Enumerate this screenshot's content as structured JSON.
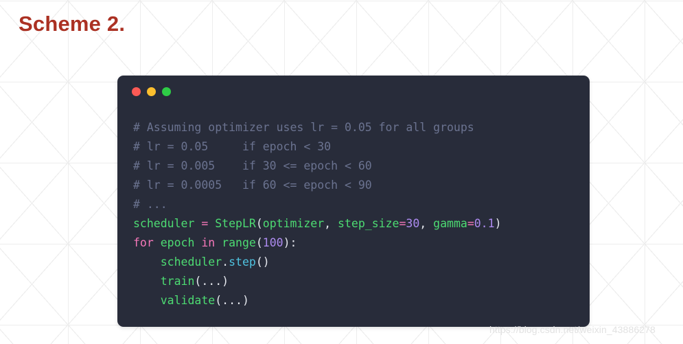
{
  "slide": {
    "title": "Scheme 2.",
    "title_color": "#ab3123",
    "background_color": "#ffffff",
    "grid_line_color": "#ededed"
  },
  "code_window": {
    "background_color": "#282c3a",
    "controls": [
      {
        "name": "close",
        "color": "#fc5a55"
      },
      {
        "name": "minimize",
        "color": "#fcbf2e"
      },
      {
        "name": "maximize",
        "color": "#2ecc46"
      }
    ],
    "language": "python",
    "palette": {
      "comment": "#6b7390",
      "name": "#4ddb72",
      "keyword": "#f778ba",
      "operator": "#f778ba",
      "number": "#ad8bf0",
      "method": "#4fc3e0",
      "punctuation": "#e6e9ef"
    },
    "code_plain_text": "# Assuming optimizer uses lr = 0.05 for all groups\n# lr = 0.05     if epoch < 30\n# lr = 0.005    if 30 <= epoch < 60\n# lr = 0.0005   if 60 <= epoch < 90\n# ...\nscheduler = StepLR(optimizer, step_size=30, gamma=0.1)\nfor epoch in range(100):\n    scheduler.step()\n    train(...)\n    validate(...)",
    "lines": [
      {
        "id": "line-1",
        "tokens": [
          {
            "t": "comment",
            "s": "# Assuming optimizer uses lr = 0.05 for all groups"
          }
        ]
      },
      {
        "id": "line-2",
        "tokens": [
          {
            "t": "comment",
            "s": "# lr = 0.05     if epoch < 30"
          }
        ]
      },
      {
        "id": "line-3",
        "tokens": [
          {
            "t": "comment",
            "s": "# lr = 0.005    if 30 <= epoch < 60"
          }
        ]
      },
      {
        "id": "line-4",
        "tokens": [
          {
            "t": "comment",
            "s": "# lr = 0.0005   if 60 <= epoch < 90"
          }
        ]
      },
      {
        "id": "line-5",
        "tokens": [
          {
            "t": "comment",
            "s": "# ..."
          }
        ]
      },
      {
        "id": "line-6",
        "tokens": [
          {
            "t": "name",
            "s": "scheduler"
          },
          {
            "t": "punct",
            "s": " "
          },
          {
            "t": "operator",
            "s": "="
          },
          {
            "t": "punct",
            "s": " "
          },
          {
            "t": "name",
            "s": "StepLR"
          },
          {
            "t": "punct",
            "s": "("
          },
          {
            "t": "name",
            "s": "optimizer"
          },
          {
            "t": "punct",
            "s": ", "
          },
          {
            "t": "name",
            "s": "step_size"
          },
          {
            "t": "operator",
            "s": "="
          },
          {
            "t": "number",
            "s": "30"
          },
          {
            "t": "punct",
            "s": ", "
          },
          {
            "t": "name",
            "s": "gamma"
          },
          {
            "t": "operator",
            "s": "="
          },
          {
            "t": "number",
            "s": "0.1"
          },
          {
            "t": "punct",
            "s": ")"
          }
        ]
      },
      {
        "id": "line-7",
        "tokens": [
          {
            "t": "keyword",
            "s": "for"
          },
          {
            "t": "punct",
            "s": " "
          },
          {
            "t": "name",
            "s": "epoch"
          },
          {
            "t": "punct",
            "s": " "
          },
          {
            "t": "keyword",
            "s": "in"
          },
          {
            "t": "punct",
            "s": " "
          },
          {
            "t": "name",
            "s": "range"
          },
          {
            "t": "punct",
            "s": "("
          },
          {
            "t": "number",
            "s": "100"
          },
          {
            "t": "punct",
            "s": "):"
          }
        ]
      },
      {
        "id": "line-8",
        "tokens": [
          {
            "t": "punct",
            "s": "    "
          },
          {
            "t": "name",
            "s": "scheduler"
          },
          {
            "t": "punct",
            "s": "."
          },
          {
            "t": "method",
            "s": "step"
          },
          {
            "t": "punct",
            "s": "()"
          }
        ]
      },
      {
        "id": "line-9",
        "tokens": [
          {
            "t": "punct",
            "s": "    "
          },
          {
            "t": "name",
            "s": "train"
          },
          {
            "t": "punct",
            "s": "(...)"
          }
        ]
      },
      {
        "id": "line-10",
        "tokens": [
          {
            "t": "punct",
            "s": "    "
          },
          {
            "t": "name",
            "s": "validate"
          },
          {
            "t": "punct",
            "s": "(...)"
          }
        ]
      }
    ]
  },
  "watermark": {
    "text": "https://blog.csdn.net/weixin_43886278"
  }
}
